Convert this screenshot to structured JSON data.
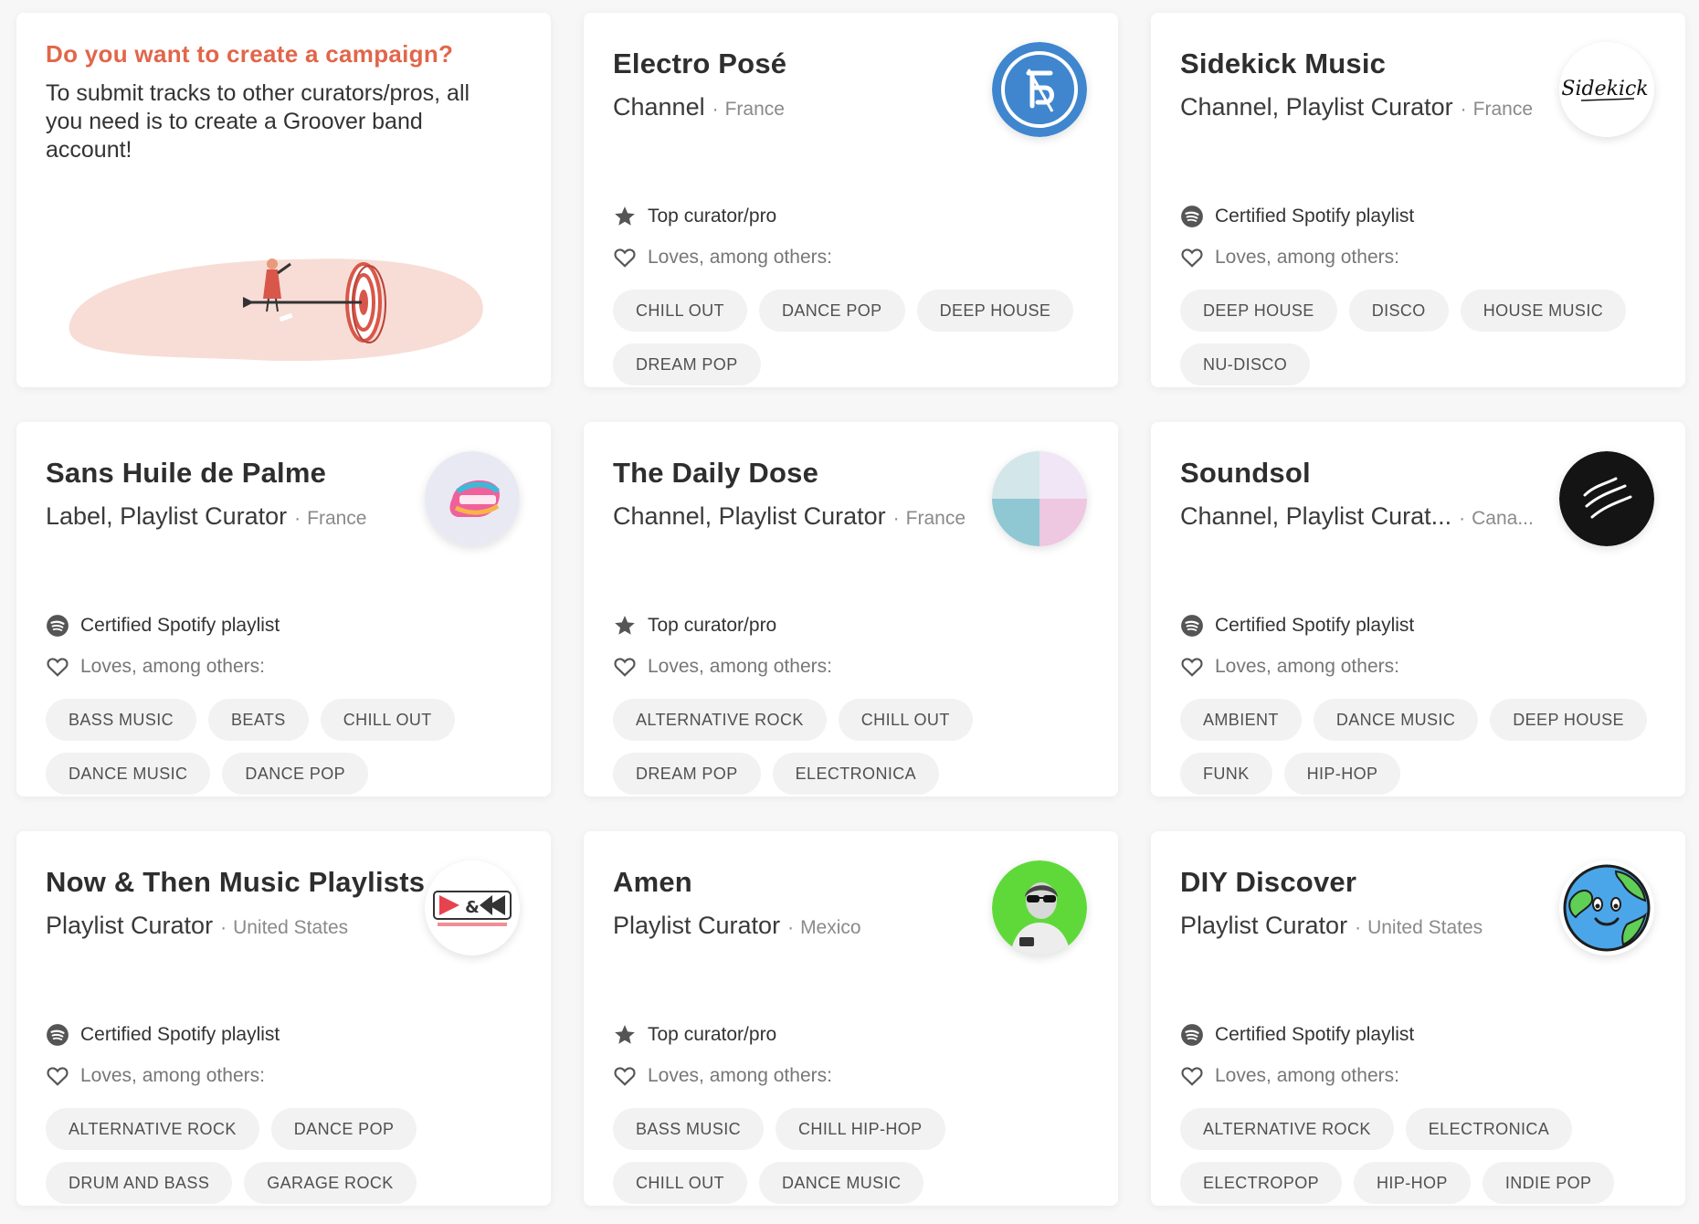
{
  "campaign": {
    "title": "Do you want to create a campaign?",
    "text": "To submit tracks to other curators/pros, all you need is to create a Groover band account!"
  },
  "labels": {
    "loves": "Loves, among others:"
  },
  "colors": {
    "accent": "#e1664a",
    "tag_bg": "#f2f2f2"
  },
  "curators": [
    {
      "name": "Electro Posé",
      "role": "Channel",
      "country": "France",
      "badge": "Top curator/pro",
      "badge_icon": "star-icon",
      "avatar_icon": "electro-pose-logo",
      "tags": [
        "CHILL OUT",
        "DANCE POP",
        "DEEP HOUSE",
        "DREAM POP"
      ]
    },
    {
      "name": "Sidekick Music",
      "role": "Channel, Playlist Curator",
      "country": "France",
      "badge": "Certified Spotify playlist",
      "badge_icon": "spotify-icon",
      "avatar_icon": "sidekick-logo",
      "avatar_text": "Sidekick",
      "tags": [
        "DEEP HOUSE",
        "DISCO",
        "HOUSE MUSIC",
        "NU-DISCO"
      ]
    },
    {
      "name": "Sans Huile de Palme",
      "role": "Label, Playlist Curator",
      "country": "France",
      "badge": "Certified Spotify playlist",
      "badge_icon": "spotify-icon",
      "avatar_icon": "sans-huile-logo",
      "tags": [
        "BASS MUSIC",
        "BEATS",
        "CHILL OUT",
        "DANCE MUSIC",
        "DANCE POP"
      ]
    },
    {
      "name": "The Daily Dose",
      "role": "Channel, Playlist Curator",
      "country": "France",
      "badge": "Top curator/pro",
      "badge_icon": "star-icon",
      "avatar_icon": "daily-dose-logo",
      "tags": [
        "ALTERNATIVE ROCK",
        "CHILL OUT",
        "DREAM POP",
        "ELECTRONICA"
      ]
    },
    {
      "name": "Soundsol",
      "role": "Channel, Playlist Curat...",
      "country": "Cana...",
      "badge": "Certified Spotify playlist",
      "badge_icon": "spotify-icon",
      "avatar_icon": "soundsol-logo",
      "tags": [
        "AMBIENT",
        "DANCE MUSIC",
        "DEEP HOUSE",
        "FUNK",
        "HIP-HOP"
      ]
    },
    {
      "name": "Now & Then Music Playlists",
      "role": "Playlist Curator",
      "country": "United States",
      "badge": "Certified Spotify playlist",
      "badge_icon": "spotify-icon",
      "avatar_icon": "now-then-logo",
      "tags": [
        "ALTERNATIVE ROCK",
        "DANCE POP",
        "DRUM AND BASS",
        "GARAGE ROCK"
      ]
    },
    {
      "name": "Amen",
      "role": "Playlist Curator",
      "country": "Mexico",
      "badge": "Top curator/pro",
      "badge_icon": "star-icon",
      "avatar_icon": "amen-photo",
      "tags": [
        "BASS MUSIC",
        "CHILL HIP-HOP",
        "CHILL OUT",
        "DANCE MUSIC"
      ]
    },
    {
      "name": "DIY Discover",
      "role": "Playlist Curator",
      "country": "United States",
      "badge": "Certified Spotify playlist",
      "badge_icon": "spotify-icon",
      "avatar_icon": "earth-icon",
      "tags": [
        "ALTERNATIVE ROCK",
        "ELECTRONICA",
        "ELECTROPOP",
        "HIP-HOP",
        "INDIE POP"
      ]
    }
  ]
}
